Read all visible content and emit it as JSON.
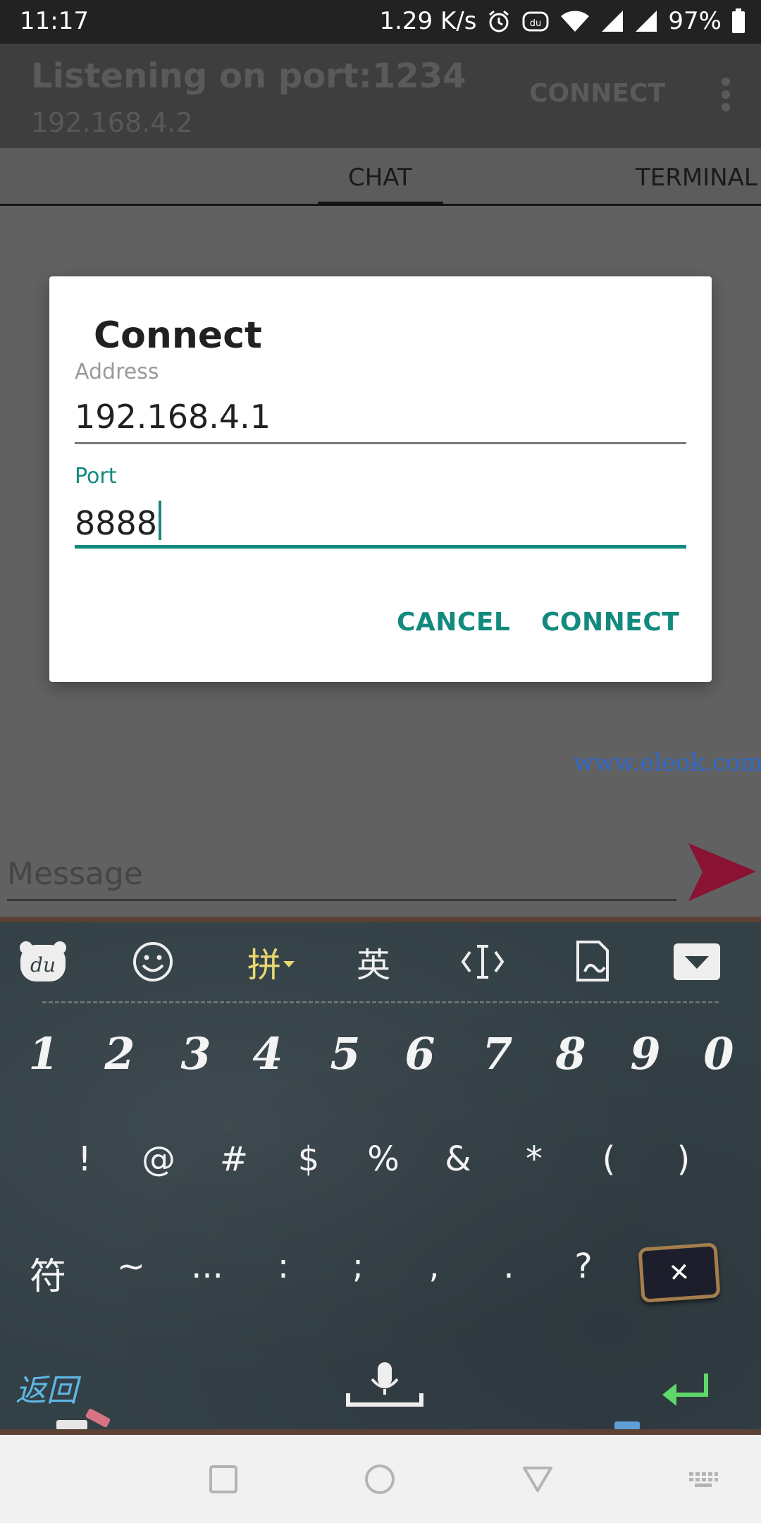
{
  "status_bar": {
    "time": "11:17",
    "network_speed": "1.29 K/s",
    "battery": "97%",
    "icons": [
      "alarm-icon",
      "du-keyboard-icon",
      "wifi-icon",
      "signal-icon",
      "signal-icon",
      "battery-icon"
    ]
  },
  "app_bar": {
    "title": "Listening on port:1234",
    "subtitle": "192.168.4.2",
    "connect_label": "CONNECT"
  },
  "tabs": [
    {
      "label": "CHAT",
      "selected": true
    },
    {
      "label": "TERMINAL",
      "selected": false
    }
  ],
  "watermark": "www.eleok.com",
  "message": {
    "placeholder": "Message"
  },
  "dialog": {
    "title": "Connect",
    "address_label": "Address",
    "address_value": "192.168.4.1",
    "port_label": "Port",
    "port_value": "8888",
    "cancel_label": "CANCEL",
    "connect_label": "CONNECT"
  },
  "colors": {
    "accent": "#138a7e",
    "send": "#8a1232",
    "chalkboard": "#334046"
  },
  "keyboard": {
    "toolbar": [
      {
        "name": "du-logo-icon",
        "label": ""
      },
      {
        "name": "emoji-icon",
        "label": ""
      },
      {
        "name": "pinyin-switch",
        "label": "拼"
      },
      {
        "name": "english-switch",
        "label": "英"
      },
      {
        "name": "cursor-move-icon",
        "label": ""
      },
      {
        "name": "clipboard-icon",
        "label": ""
      },
      {
        "name": "hide-keyboard-icon",
        "label": ""
      }
    ],
    "number_row": [
      "1",
      "2",
      "3",
      "4",
      "5",
      "6",
      "7",
      "8",
      "9",
      "0"
    ],
    "symbol_row": [
      "!",
      "@",
      "#",
      "$",
      "%",
      "&",
      "*",
      "(",
      ")"
    ],
    "punctuation_row": [
      "符",
      "~",
      "...",
      ":",
      ";",
      ",",
      ".",
      "?"
    ],
    "back_label": "返回"
  }
}
